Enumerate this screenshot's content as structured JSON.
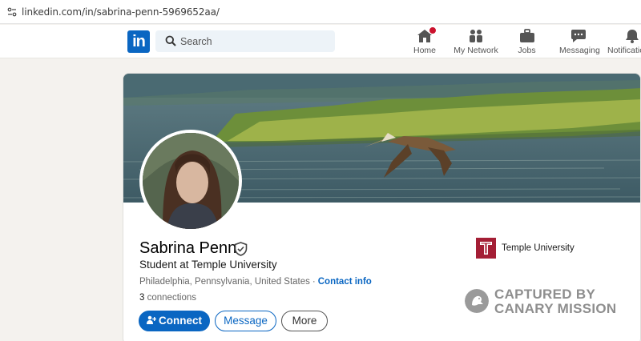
{
  "browser": {
    "url": "linkedin.com/in/sabrina-penn-5969652aa/"
  },
  "nav": {
    "logo_text": "in",
    "search_placeholder": "Search",
    "items": [
      {
        "label": "Home",
        "icon": "home-icon"
      },
      {
        "label": "My Network",
        "icon": "network-icon"
      },
      {
        "label": "Jobs",
        "icon": "briefcase-icon"
      },
      {
        "label": "Messaging",
        "icon": "messaging-icon"
      },
      {
        "label": "Notifications",
        "icon": "bell-icon"
      }
    ],
    "accent": "#0a66c2",
    "badge_color": "#cb112d"
  },
  "profile": {
    "name": "Sabrina Penn",
    "headline": "Student at Temple University",
    "location": "Philadelphia, Pennsylvania, United States",
    "separator": "·",
    "contact_info": "Contact info",
    "connections_count": "3",
    "connections_label": "connections",
    "buttons": {
      "connect": "Connect",
      "message": "Message",
      "more": "More"
    }
  },
  "education": {
    "school": "Temple University",
    "logo_color": "#a41e35"
  },
  "watermark": {
    "line1": "CAPTURED BY",
    "line2": "CANARY MISSION"
  }
}
